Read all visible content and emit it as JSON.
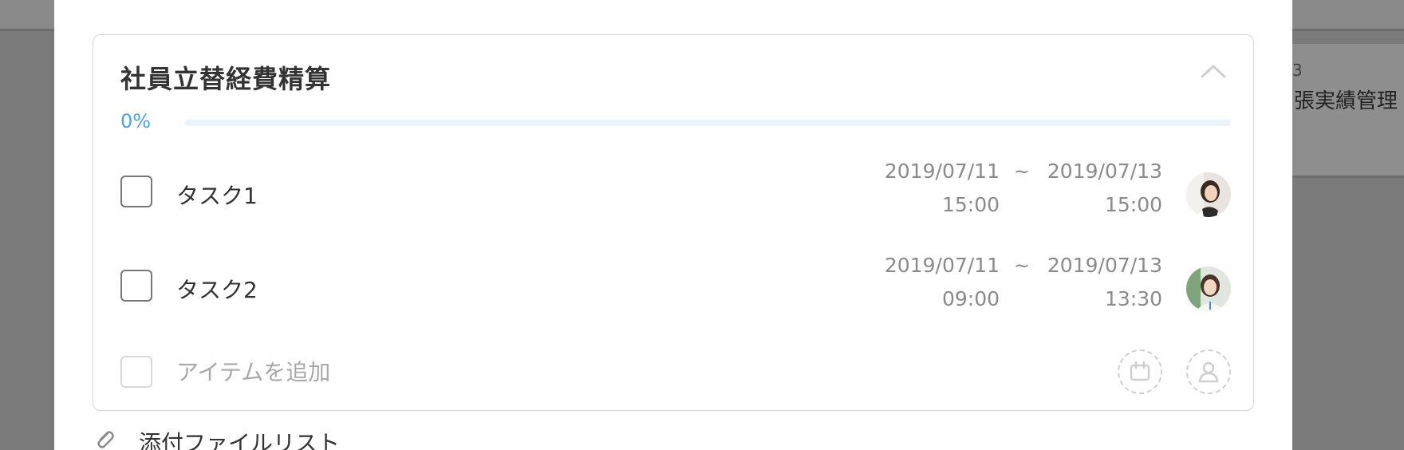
{
  "background": {
    "card_number": "3",
    "card_title": "張実績管理"
  },
  "checklist": {
    "title": "社員立替経費精算",
    "progress_text": "0%",
    "progress_value": 0,
    "collapse_icon": "chevron-up-icon",
    "tasks": [
      {
        "label": "タスク1",
        "start_date": "2019/07/11",
        "start_time": "15:00",
        "separator": "~",
        "end_date": "2019/07/13",
        "end_time": "15:00",
        "assignee_icon": "avatar"
      },
      {
        "label": "タスク2",
        "start_date": "2019/07/11",
        "start_time": "09:00",
        "separator": "~",
        "end_date": "2019/07/13",
        "end_time": "13:30",
        "assignee_icon": "avatar"
      }
    ],
    "add_item": {
      "placeholder": "アイテムを追加",
      "date_icon": "calendar-icon",
      "assignee_icon": "user-icon"
    }
  },
  "attachments": {
    "label": "添付ファイルリスト",
    "icon": "paperclip-icon"
  },
  "colors": {
    "accent": "#4aa3e6",
    "overlay": "#7a7a7a"
  }
}
